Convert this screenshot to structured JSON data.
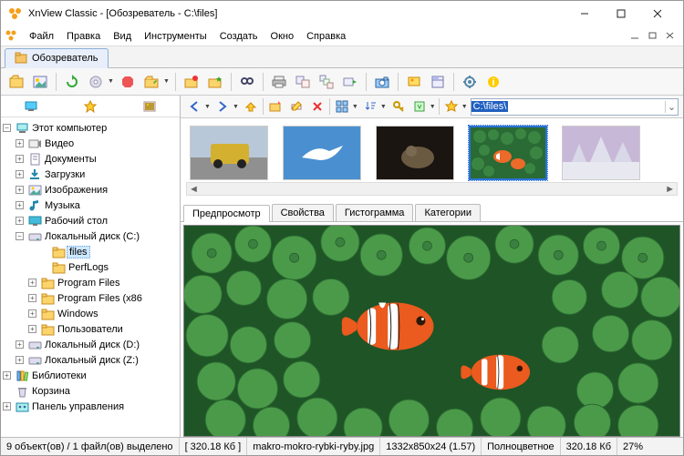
{
  "title": "XnView Classic - [Обозреватель - C:\\files]",
  "menu": {
    "file": "Файл",
    "edit": "Правка",
    "view": "Вид",
    "tools": "Инструменты",
    "create": "Создать",
    "window": "Окно",
    "help": "Справка"
  },
  "doctab": {
    "label": "Обозреватель"
  },
  "address": {
    "path": "C:\\files\\"
  },
  "tree": {
    "root": "Этот компьютер",
    "video": "Видео",
    "documents": "Документы",
    "downloads": "Загрузки",
    "images": "Изображения",
    "music": "Музыка",
    "desktop": "Рабочий стол",
    "disk_c": "Локальный диск (C:)",
    "folder_files": "files",
    "folder_perflogs": "PerfLogs",
    "folder_pf": "Program Files",
    "folder_pf86": "Program Files (x86",
    "folder_windows": "Windows",
    "folder_users": "Пользователи",
    "disk_d": "Локальный диск (D:)",
    "disk_z": "Локальный диск (Z:)",
    "libraries": "Библиотеки",
    "recycle": "Корзина",
    "control": "Панель управления"
  },
  "panel_tabs": {
    "preview": "Предпросмотр",
    "properties": "Свойства",
    "histogram": "Гистограмма",
    "categories": "Категории"
  },
  "status": {
    "objects": "9 объект(ов) / 1 файл(ов) выделено",
    "size": "[ 320.18 Кб ]",
    "filename": "makro-mokro-rybki-ryby.jpg",
    "dimensions": "1332x850x24 (1.57)",
    "colormode": "Полноцветное",
    "filesize": "320.18 Кб",
    "zoom": "27%"
  }
}
